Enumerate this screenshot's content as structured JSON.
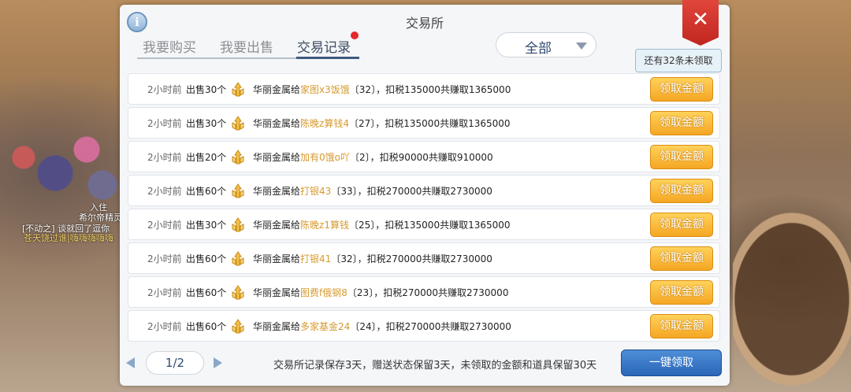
{
  "background": {
    "texts": [
      "入住",
      "希尔帝精灵",
      "[不动之] 谈就回了逗你",
      "苍天饶过谁|嗨嗨嗨嗨嗨"
    ]
  },
  "header": {
    "info_icon": "info-icon",
    "title": "交易所",
    "close_icon": "close-icon"
  },
  "tabs": [
    {
      "label": "我要购买",
      "active": false
    },
    {
      "label": "我要出售",
      "active": false
    },
    {
      "label": "交易记录",
      "active": true,
      "notification_dot": true
    }
  ],
  "filter": {
    "selected": "全部"
  },
  "tooltip": "还有32条未领取",
  "records": [
    {
      "time": "2小时前",
      "action": "出售30个",
      "buyer_prefix": "华丽金属给",
      "buyer": "家图x3饭饿",
      "qty": "32",
      "tax_text": "，扣税135000共赚取1365000",
      "button": "领取金额"
    },
    {
      "time": "2小时前",
      "action": "出售30个",
      "buyer_prefix": "华丽金属给",
      "buyer": "陈晚z算钱4",
      "qty": "27",
      "tax_text": "，扣税135000共赚取1365000",
      "button": "领取金额"
    },
    {
      "time": "2小时前",
      "action": "出售20个",
      "buyer_prefix": "华丽金属给",
      "buyer": "加有0饿o吖",
      "qty": "2",
      "tax_text": "，扣税90000共赚取910000",
      "button": "领取金额"
    },
    {
      "time": "2小时前",
      "action": "出售60个",
      "buyer_prefix": "华丽金属给",
      "buyer": "打银43",
      "qty": "33",
      "tax_text": "，扣税270000共赚取2730000",
      "button": "领取金额"
    },
    {
      "time": "2小时前",
      "action": "出售30个",
      "buyer_prefix": "华丽金属给",
      "buyer": "陈晚z1算钱",
      "qty": "25",
      "tax_text": "，扣税135000共赚取1365000",
      "button": "领取金额"
    },
    {
      "time": "2小时前",
      "action": "出售60个",
      "buyer_prefix": "华丽金属给",
      "buyer": "打银41",
      "qty": "32",
      "tax_text": "，扣税270000共赚取2730000",
      "button": "领取金额"
    },
    {
      "time": "2小时前",
      "action": "出售60个",
      "buyer_prefix": "华丽金属给",
      "buyer": "图费f俄钢8",
      "qty": "23",
      "tax_text": "，扣税270000共赚取2730000",
      "button": "领取金额"
    },
    {
      "time": "2小时前",
      "action": "出售60个",
      "buyer_prefix": "华丽金属给",
      "buyer": "多家基金24",
      "qty": "24",
      "tax_text": "，扣税270000共赚取2730000",
      "button": "领取金额"
    }
  ],
  "footer": {
    "page": "1/2",
    "note": "交易所记录保存3天，赠送状态保留3天，未领取的金额和道具保留30天",
    "collect_all": "一键领取"
  },
  "colors": {
    "accent_blue": "#3e5a80",
    "claim_orange": "#f5a623",
    "buyer_name": "#d69a2e",
    "close_red": "#d0322a",
    "notification_red": "#e5282e"
  }
}
